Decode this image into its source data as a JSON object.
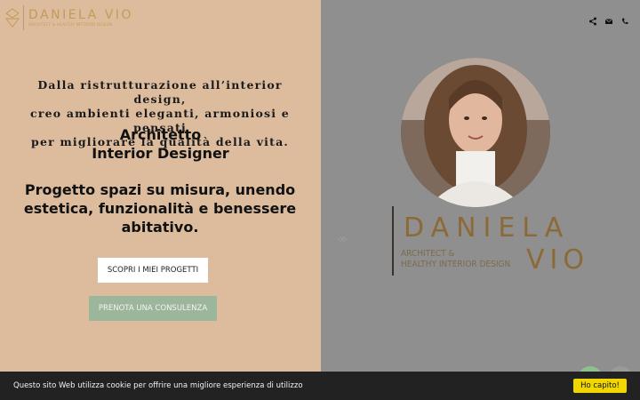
{
  "header": {
    "logo_name": "DANIELA VIO",
    "logo_sub": "ARCHITECT & HEALTHY INTERIOR DESIGN",
    "icons": [
      "share-icon",
      "mail-icon",
      "phone-icon"
    ]
  },
  "hero": {
    "quote_lines": [
      "Dalla ristrutturazione all’interior design,",
      "creo ambienti eleganti, armoniosi e pensati",
      "per migliorare la qualità della vita."
    ],
    "role_lines": [
      "Architetto",
      "Interior Designer"
    ],
    "desc_lines": [
      "Progetto spazi su misura, unendo",
      "estetica, funzionalità e benessere",
      "abitativo."
    ],
    "cta_projects": "SCOPRI I MIEI PROGETTI",
    "cta_consult": "PRENOTA UNA CONSULENZA"
  },
  "brand": {
    "name_line1": "DANIELA",
    "name_line2": "VIO",
    "sub_line1": "ARCHITECT &",
    "sub_line2": "HEALTHY INTERIOR DESIGN"
  },
  "cookie": {
    "text": "Questo sito Web utilizza cookie per offrire una migliore esperienza di utilizzo",
    "button": "Ho capito!"
  },
  "colors": {
    "left_panel": "#dcbc9d",
    "right_panel": "#8f8f8f",
    "gold": "#c39a58",
    "green_button": "#9bb69b",
    "cookie_button": "#f1d600"
  }
}
